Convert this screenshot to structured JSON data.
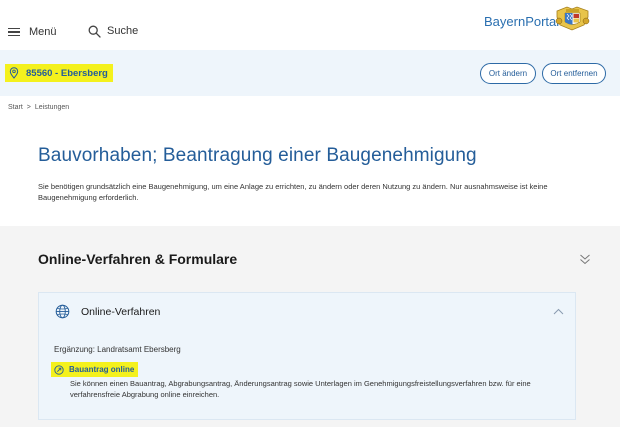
{
  "header": {
    "menu_label": "Menü",
    "search_label": "Suche",
    "brand": "BayernPortal"
  },
  "location": {
    "label": "85560 - Ebersberg",
    "change_label": "Ort ändern",
    "remove_label": "Ort entfernen"
  },
  "breadcrumb": {
    "items": [
      "Start",
      "Leistungen"
    ],
    "separator": ">"
  },
  "page": {
    "title": "Bauvorhaben; Beantragung einer Baugenehmigung",
    "intro": "Sie benötigen grundsätzlich eine Baugenehmigung, um eine Anlage zu errichten, zu ändern oder deren Nutzung zu ändern. Nur ausnahmsweise ist keine Baugenehmigung erforderlich."
  },
  "online_section": {
    "title": "Online-Verfahren & Formulare",
    "card": {
      "title": "Online-Verfahren",
      "supplement": "Ergänzung: Landratsamt Ebersberg",
      "link_label": "Bauantrag online",
      "link_description": "Sie können einen Bauantrag, Abgrabungsantrag, Änderungsantrag sowie Unterlagen im Genehmigungsfreistellungsverfahren bzw. für eine verfahrensfreie Abgrabung online einreichen."
    }
  },
  "colors": {
    "accent": "#245d99",
    "highlight": "#f4f11d",
    "location_bar_bg": "#eef5fb",
    "section_bg": "#f4f4f4"
  },
  "icons": [
    "hamburger-icon",
    "search-icon",
    "bavarian-crest-icon",
    "location-pin-icon",
    "double-chevron-down-icon",
    "globe-icon",
    "chevron-up-icon",
    "external-link-icon"
  ]
}
